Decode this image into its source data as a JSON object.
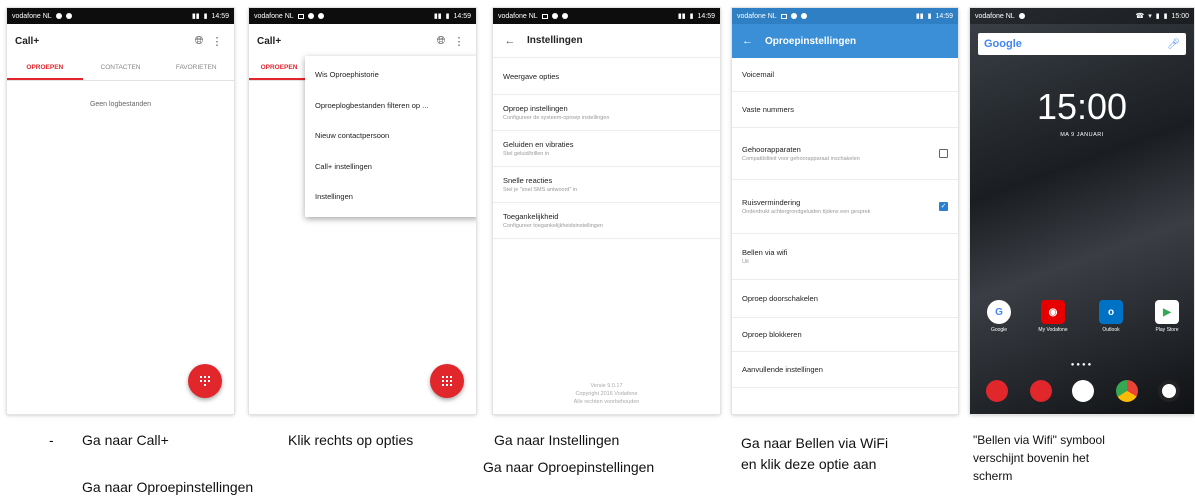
{
  "status": {
    "carrier": "vodafone NL",
    "time": "14:59",
    "time_home": "15:00"
  },
  "screen1": {
    "title": "Call+",
    "tabs": [
      "OPROEPEN",
      "CONTACTEN",
      "FAVORIETEN"
    ],
    "empty": "Geen logbestanden"
  },
  "screen2": {
    "title": "Call+",
    "tab_partial": "OPROEPEN",
    "menu": [
      "Wis Oproephistorie",
      "Oproeplogbestanden filteren op ...",
      "Nieuw contactpersoon",
      "Call+ instellingen",
      "Instellingen"
    ]
  },
  "screen3": {
    "title": "Instellingen",
    "items": [
      {
        "title": "Weergave opties",
        "sub": ""
      },
      {
        "title": "Oproep instellingen",
        "sub": "Configureer de systeem-oproep instellingen"
      },
      {
        "title": "Geluiden en vibraties",
        "sub": "Stel geluid/trillen in"
      },
      {
        "title": "Snelle reacties",
        "sub": "Stel je \"snel SMS antwoord\" in"
      },
      {
        "title": "Toegankelijkheid",
        "sub": "Configureer toegankelijkheidsinstellingen"
      }
    ],
    "footer": [
      "Versie 9.0.17",
      "Copyright 2016 Vodafone",
      "Alle rechten voorbehouden"
    ]
  },
  "screen4": {
    "title": "Oproepinstellingen",
    "items": [
      {
        "title": "Voicemail",
        "sub": ""
      },
      {
        "title": "Vaste nummers",
        "sub": ""
      },
      {
        "title": "Gehoorapparaten",
        "sub": "Compatibiliteit voor gehoorapparaat inschakelen"
      },
      {
        "title": "Ruisvermindering",
        "sub": "Onderdrukt achtergrondgeluiden tijdens een gesprek"
      },
      {
        "title": "Bellen via wifi",
        "sub": "Uit"
      },
      {
        "title": "Oproep doorschakelen",
        "sub": ""
      },
      {
        "title": "Oproep blokkeren",
        "sub": ""
      },
      {
        "title": "Aanvullende instellingen",
        "sub": ""
      }
    ]
  },
  "screen5": {
    "search_logo": "Google",
    "clock": "15:00",
    "date": "MA 9 JANUARI",
    "apps": [
      "Google",
      "My Vodafone",
      "Outlook",
      "Play Store"
    ]
  },
  "captions": {
    "c1": "-",
    "c1b": "Ga naar Call+",
    "c1c": "Ga naar Oproepinstellingen",
    "c2": "Klik rechts op opties",
    "c3": "Ga naar Instellingen",
    "c3b": "Ga naar Oproepinstellingen",
    "c4": "Ga naar Bellen via WiFi",
    "c4b": "en klik deze optie aan",
    "c5": "\"Bellen via Wifi\" symbool",
    "c5b": "verschijnt bovenin het",
    "c5c": "scherm"
  },
  "colors": {
    "accent_red": "#e1262c",
    "blue": "#3a8fd6"
  }
}
